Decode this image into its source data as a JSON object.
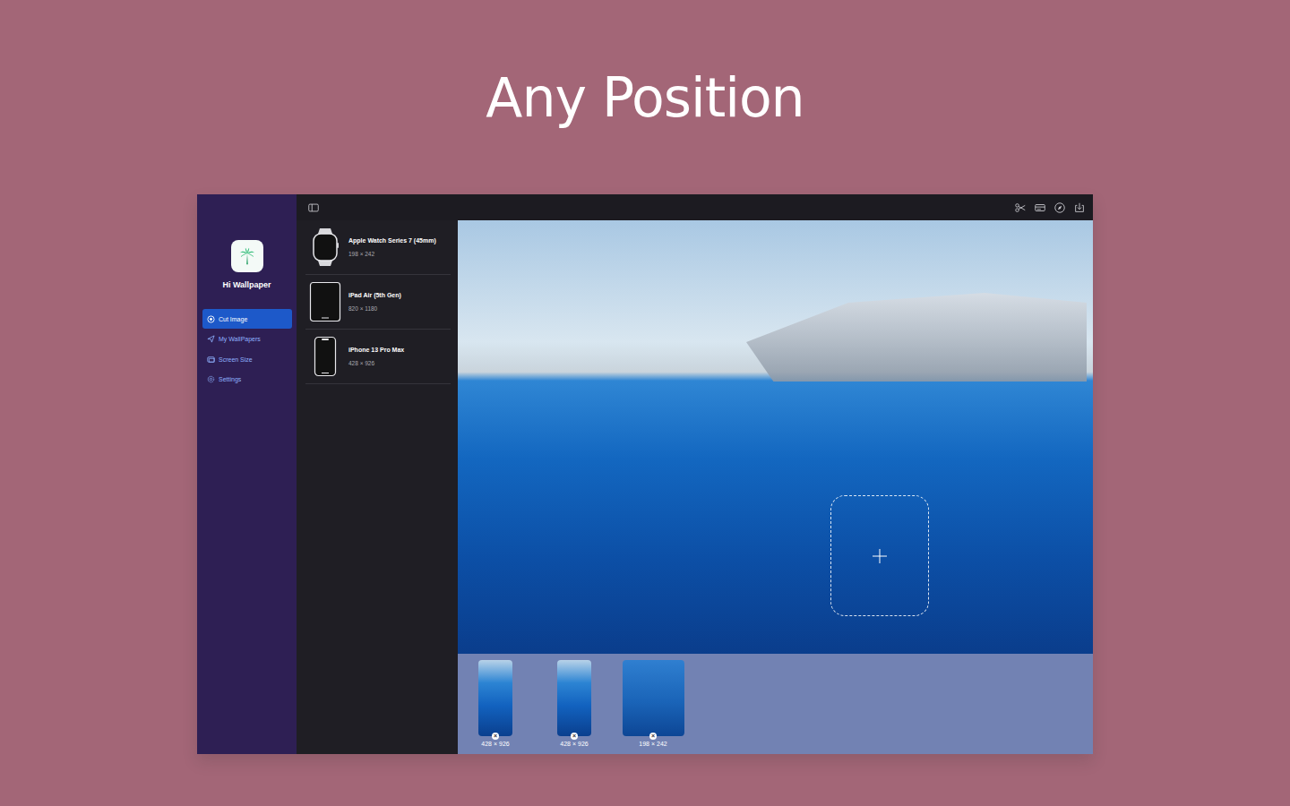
{
  "headline": "Any Position",
  "app": {
    "name": "Hi Wallpaper"
  },
  "sidebar": {
    "items": [
      {
        "label": "Cut Image",
        "selected": true
      },
      {
        "label": "My WallPapers",
        "selected": false
      },
      {
        "label": "Screen Size",
        "selected": false
      },
      {
        "label": "Settings",
        "selected": false
      }
    ]
  },
  "devices": [
    {
      "name": "Apple Watch Series 7 (45mm)",
      "size": "198 × 242",
      "kind": "watch"
    },
    {
      "name": "iPad Air (5th Gen)",
      "size": "820 × 1180",
      "kind": "tablet"
    },
    {
      "name": "iPhone 13 Pro Max",
      "size": "428 × 926",
      "kind": "phone"
    }
  ],
  "crops": [
    {
      "size": "428 × 926",
      "remove": "×",
      "kind": "portrait"
    },
    {
      "size": "428 × 926",
      "remove": "×",
      "kind": "portrait"
    },
    {
      "size": "198 × 242",
      "remove": "×",
      "kind": "wide"
    }
  ]
}
